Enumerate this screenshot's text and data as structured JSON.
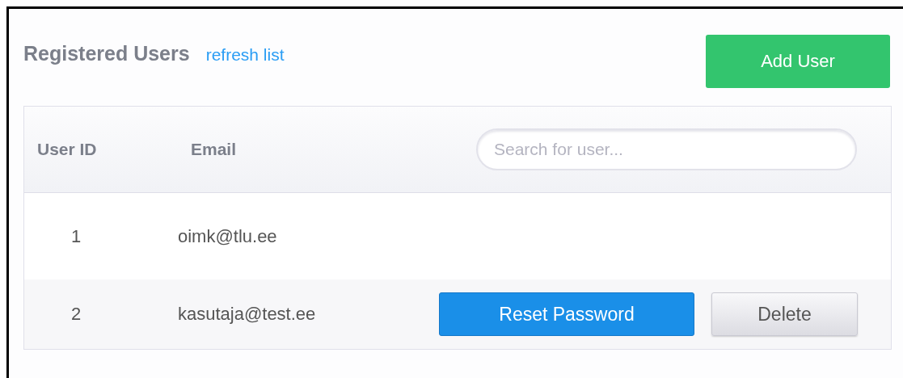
{
  "header": {
    "title": "Registered Users",
    "refresh_link": "refresh list",
    "add_button": "Add User"
  },
  "table": {
    "columns": [
      "User ID",
      "Email"
    ],
    "search": {
      "placeholder": "Search for user..."
    },
    "rows": [
      {
        "id": "1",
        "email": "oimk@tlu.ee",
        "hovered": false,
        "actions": []
      },
      {
        "id": "2",
        "email": "kasutaja@test.ee",
        "hovered": true,
        "actions": [
          {
            "label": "Reset Password",
            "kind": "primary"
          },
          {
            "label": "Delete",
            "kind": "secondary"
          }
        ]
      }
    ]
  }
}
